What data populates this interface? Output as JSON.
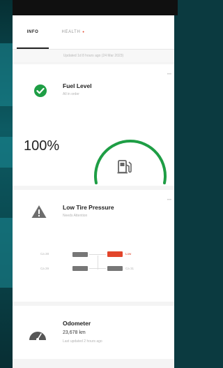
{
  "tabs": [
    {
      "label": "INFO",
      "active": true
    },
    {
      "label": "HEALTH",
      "active": false,
      "alert": "•"
    }
  ],
  "updated_text": "Updated 1d 8 hours ago (24 Mar 2023)",
  "fuel": {
    "title": "Fuel Level",
    "subtitle": "All in order",
    "value": "100%",
    "level": 1.0,
    "more": "•••",
    "status_color": "#1e9e45"
  },
  "tire": {
    "title": "Low Tire Pressure",
    "subtitle": "Needs Attention",
    "more": "•••",
    "labels": {
      "front_left": "Ca 28",
      "front_right": "Low",
      "rear_left": "Ca 29",
      "rear_right": "Ca 31"
    },
    "alert_color": "#e2452b"
  },
  "odometer": {
    "title": "Odometer",
    "value": "23,678 km",
    "note": "Last updated 2 hours ago"
  },
  "colors": {
    "accent_green": "#1e9e45",
    "alert": "#e2452b"
  }
}
